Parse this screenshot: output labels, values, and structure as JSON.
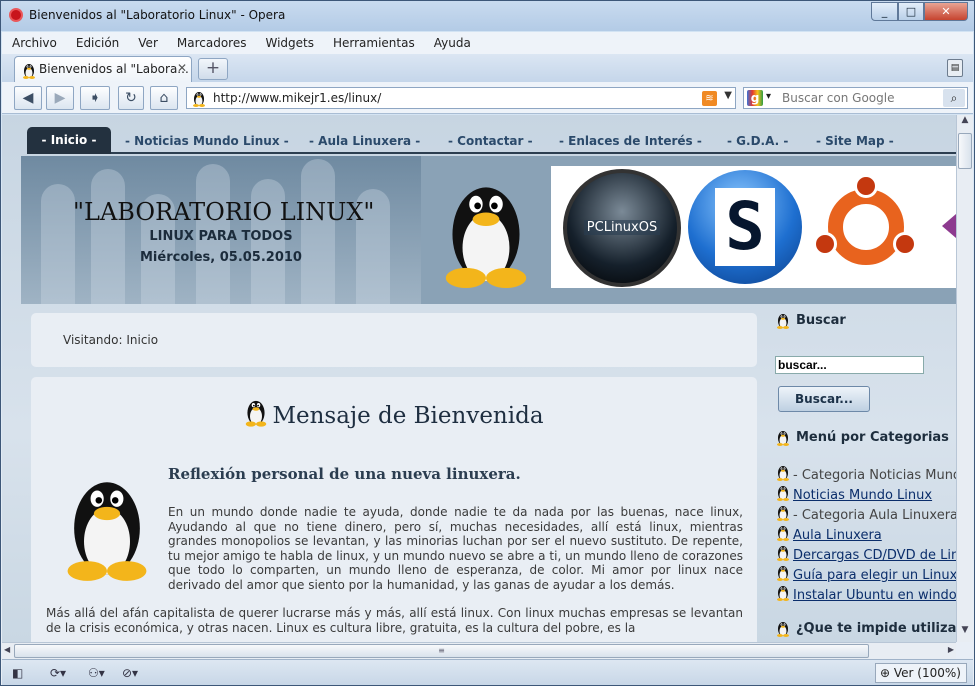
{
  "window": {
    "title": "Bienvenidos al \"Laboratorio Linux\" - Opera",
    "controls": [
      "_",
      "□",
      "✕"
    ]
  },
  "menu": [
    "Archivo",
    "Edición",
    "Ver",
    "Marcadores",
    "Widgets",
    "Herramientas",
    "Ayuda"
  ],
  "tab": {
    "label": "Bienvenidos al \"Labora...",
    "close": "✕",
    "new_tab": "+"
  },
  "nav": {
    "url": "http://www.mikejr1.es/linux/",
    "search_placeholder": "Buscar con Google"
  },
  "site": {
    "nav_tabs": [
      "- Inicio -",
      "- Noticias Mundo Linux -",
      "- Aula Linuxera -",
      "- Contactar -",
      "- Enlaces de Interés -",
      "- G.D.A. -",
      "- Site Map -"
    ],
    "header_title": "\"LABORATORIO LINUX\"",
    "header_subtitle": "LINUX PARA TODOS",
    "header_date": "Miércoles, 05.05.2010",
    "distro_label": "PCLinuxOS",
    "breadcrumb": "Visitando: Inicio",
    "welcome_title": "Mensaje de Bienvenida",
    "article_title": "Reflexión personal de una nueva linuxera.",
    "paragraph1": "En un mundo donde nadie te ayuda, donde nadie te da nada por las buenas, nace linux, Ayudando al que no tiene dinero, pero sí, muchas necesidades, allí está linux, mientras grandes monopolios se levantan, y las minorias luchan por ser el nuevo sustituto. De repente, tu mejor amigo te habla de linux, y un mundo nuevo se abre a ti, un mundo lleno de corazones que todo lo comparten, un mundo lleno de esperanza, de color. Mi amor por linux nace derivado del amor que siento por la humanidad, y las ganas de ayudar a los demás.",
    "paragraph2": "Más allá del afán capitalista de querer lucrarse más y más, allí está linux. Con linux muchas empresas se levantan de la crisis económica, y otras nacen. Linux es cultura libre, gratuita, es la cultura del pobre, es la"
  },
  "sidebar": {
    "search_heading": "Buscar",
    "search_value": "buscar...",
    "search_button": "Buscar...",
    "categories_heading": "Menú por Categorias",
    "categories": [
      {
        "label": "- Categoria Noticias Mund",
        "link": false
      },
      {
        "label": "Noticias Mundo Linux",
        "link": true
      },
      {
        "label": "- Categoria Aula Linuxera",
        "link": false
      },
      {
        "label": "Aula Linuxera",
        "link": true
      },
      {
        "label": "Dercargas CD/DVD de Linu",
        "link": true
      },
      {
        "label": "Guía para elegir un Linux",
        "link": true
      },
      {
        "label": "Instalar Ubuntu en windov",
        "link": true
      }
    ],
    "question_heading": "¿Que te impide utiliza"
  },
  "status": {
    "zoom": "Ver (100%)"
  },
  "colors": {
    "nav_active_bg": "#23313f",
    "link": "#0b2e6b",
    "close_btn": "#c6442f"
  }
}
